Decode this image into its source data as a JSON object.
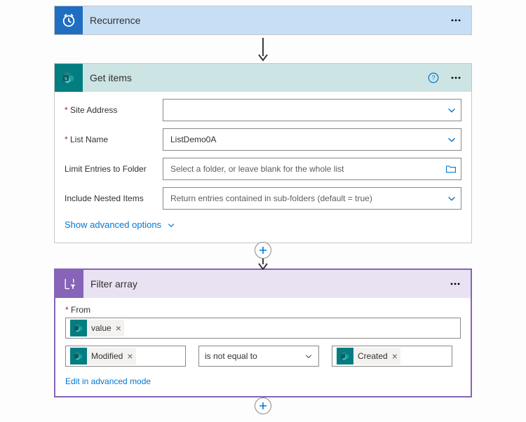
{
  "recurrence": {
    "title": "Recurrence"
  },
  "getitems": {
    "title": "Get items",
    "labels": {
      "site": "Site Address",
      "list": "List Name",
      "limit": "Limit Entries to Folder",
      "nested": "Include Nested Items"
    },
    "values": {
      "site": "",
      "list": "ListDemo0A"
    },
    "placeholders": {
      "limit": "Select a folder, or leave blank for the whole list",
      "nested": "Return entries contained in sub-folders (default = true)"
    },
    "advanced": "Show advanced options"
  },
  "filter": {
    "title": "Filter array",
    "from_label": "From",
    "tokens": {
      "value": "value",
      "modified": "Modified",
      "created": "Created"
    },
    "operator": "is not equal to",
    "edit_advanced": "Edit in advanced mode"
  }
}
